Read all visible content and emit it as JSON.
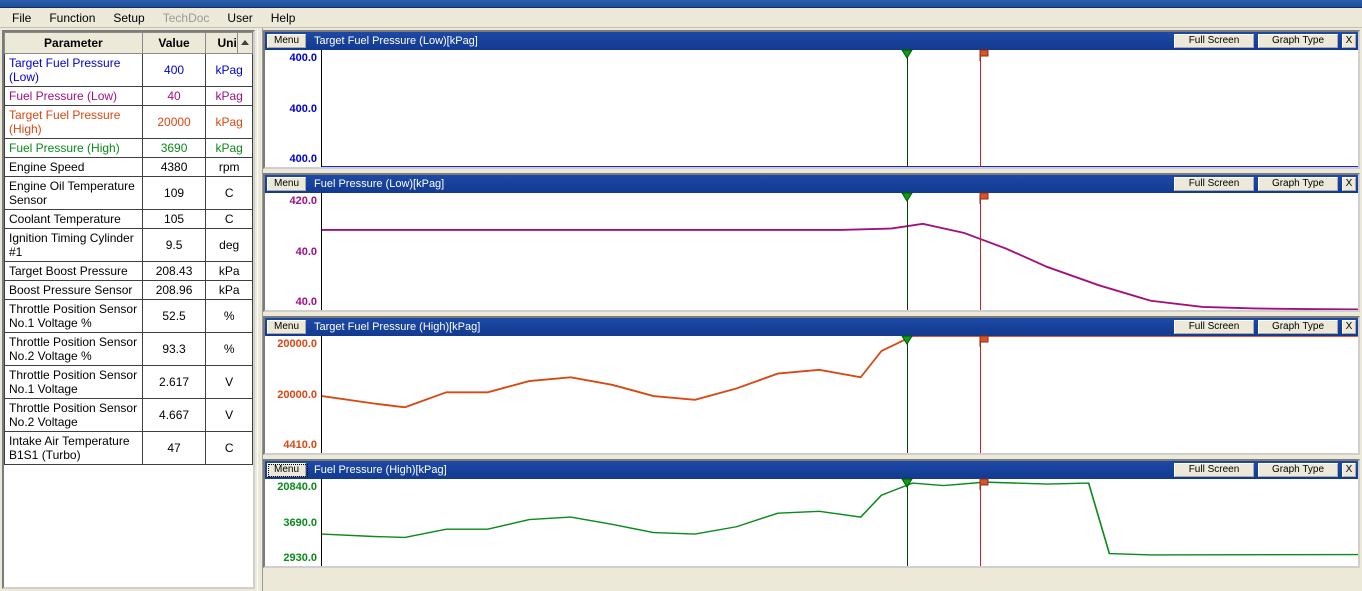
{
  "menubar": [
    "File",
    "Function",
    "Setup",
    "TechDoc",
    "User",
    "Help"
  ],
  "menubar_disabled_index": 3,
  "param_headers": {
    "name": "Parameter",
    "value": "Value",
    "unit": "Unit"
  },
  "parameters": [
    {
      "name": "Target Fuel Pressure (Low)",
      "value": "400",
      "unit": "kPag",
      "color": "#0000d0"
    },
    {
      "name": "Fuel Pressure (Low)",
      "value": "40",
      "unit": "kPag",
      "color": "#a01080"
    },
    {
      "name": "Target Fuel Pressure (High)",
      "value": "20000",
      "unit": "kPag",
      "color": "#d84810"
    },
    {
      "name": "Fuel Pressure (High)",
      "value": "3690",
      "unit": "kPag",
      "color": "#0a8a1a"
    },
    {
      "name": "Engine Speed",
      "value": "4380",
      "unit": "rpm",
      "color": "#000000"
    },
    {
      "name": "Engine Oil Temperature Sensor",
      "value": "109",
      "unit": "C",
      "color": "#000000"
    },
    {
      "name": "Coolant Temperature",
      "value": "105",
      "unit": "C",
      "color": "#000000"
    },
    {
      "name": "Ignition Timing Cylinder #1",
      "value": "9.5",
      "unit": "deg",
      "color": "#000000"
    },
    {
      "name": "Target Boost Pressure",
      "value": "208.43",
      "unit": "kPa",
      "color": "#000000"
    },
    {
      "name": "Boost Pressure Sensor",
      "value": "208.96",
      "unit": "kPa",
      "color": "#000000"
    },
    {
      "name": "Throttle Position Sensor No.1 Voltage %",
      "value": "52.5",
      "unit": "%",
      "color": "#000000"
    },
    {
      "name": "Throttle Position Sensor No.2 Voltage %",
      "value": "93.3",
      "unit": "%",
      "color": "#000000"
    },
    {
      "name": "Throttle Position Sensor No.1 Voltage",
      "value": "2.617",
      "unit": "V",
      "color": "#000000"
    },
    {
      "name": "Throttle Position Sensor No.2 Voltage",
      "value": "4.667",
      "unit": "V",
      "color": "#000000"
    },
    {
      "name": "Intake Air Temperature B1S1 (Turbo)",
      "value": "47",
      "unit": "C",
      "color": "#000000"
    }
  ],
  "graph_buttons": {
    "menu": "Menu",
    "fullscreen": "Full Screen",
    "graphtype": "Graph Type",
    "close": "X"
  },
  "cursor_positions": {
    "green_pct": 56.5,
    "red_pct": 63.5
  },
  "graphs": [
    {
      "id": "g1",
      "title": "Target Fuel Pressure (Low)[kPag]",
      "color": "#0000d0",
      "height": 135,
      "y_ticks": [
        "400.0",
        "400.0",
        "400.0"
      ]
    },
    {
      "id": "g2",
      "title": "Fuel Pressure (Low)[kPag]",
      "color": "#a01080",
      "height": 135,
      "y_ticks": [
        "420.0",
        "40.0",
        "40.0"
      ]
    },
    {
      "id": "g3",
      "title": "Target Fuel Pressure (High)[kPag]",
      "color": "#d84810",
      "height": 135,
      "y_ticks": [
        "20000.0",
        "20000.0",
        "4410.0"
      ]
    },
    {
      "id": "g4",
      "title": "Fuel Pressure (High)[kPag]",
      "color": "#0a8a1a",
      "height": 105,
      "y_ticks": [
        "20840.0",
        "3690.0",
        "2930.0"
      ],
      "menu_selected": true
    }
  ],
  "chart_data": [
    {
      "type": "line",
      "title": "Target Fuel Pressure (Low)[kPag]",
      "ylabel": "kPag",
      "ylim": [
        400,
        400
      ],
      "x": [
        0,
        100
      ],
      "series": [
        {
          "name": "Target Fuel Pressure (Low)",
          "values": [
            400,
            400
          ]
        }
      ]
    },
    {
      "type": "line",
      "title": "Fuel Pressure (Low)[kPag]",
      "ylabel": "kPag",
      "ylim": [
        40,
        420
      ],
      "x": [
        0,
        10,
        20,
        30,
        40,
        50,
        55,
        58,
        62,
        66,
        70,
        75,
        80,
        85,
        90,
        95,
        100
      ],
      "series": [
        {
          "name": "Fuel Pressure (Low)",
          "values": [
            300,
            300,
            300,
            300,
            300,
            300,
            305,
            320,
            290,
            240,
            180,
            120,
            70,
            50,
            45,
            43,
            42
          ]
        }
      ]
    },
    {
      "type": "line",
      "title": "Target Fuel Pressure (High)[kPag]",
      "ylabel": "kPag",
      "ylim": [
        4410,
        20000
      ],
      "x": [
        0,
        5,
        8,
        12,
        16,
        20,
        24,
        28,
        32,
        36,
        40,
        44,
        48,
        52,
        54,
        57,
        60,
        100
      ],
      "series": [
        {
          "name": "Target Fuel Pressure (High)",
          "values": [
            12000,
            11000,
            10500,
            12500,
            12500,
            14000,
            14500,
            13500,
            12000,
            11500,
            13000,
            15000,
            15500,
            14500,
            18000,
            20000,
            20000,
            20000
          ]
        }
      ]
    },
    {
      "type": "line",
      "title": "Fuel Pressure (High)[kPag]",
      "ylabel": "kPag",
      "ylim": [
        2930,
        20840
      ],
      "x": [
        0,
        5,
        8,
        12,
        16,
        20,
        24,
        28,
        32,
        36,
        40,
        44,
        48,
        52,
        54,
        57,
        60,
        64,
        70,
        74,
        76,
        80,
        100
      ],
      "series": [
        {
          "name": "Fuel Pressure (High)",
          "values": [
            9500,
            9000,
            8800,
            10500,
            10500,
            12500,
            13000,
            11500,
            9800,
            9500,
            11000,
            13800,
            14200,
            13000,
            17500,
            20000,
            19500,
            20200,
            19800,
            20000,
            5500,
            5200,
            5300
          ]
        }
      ]
    }
  ]
}
